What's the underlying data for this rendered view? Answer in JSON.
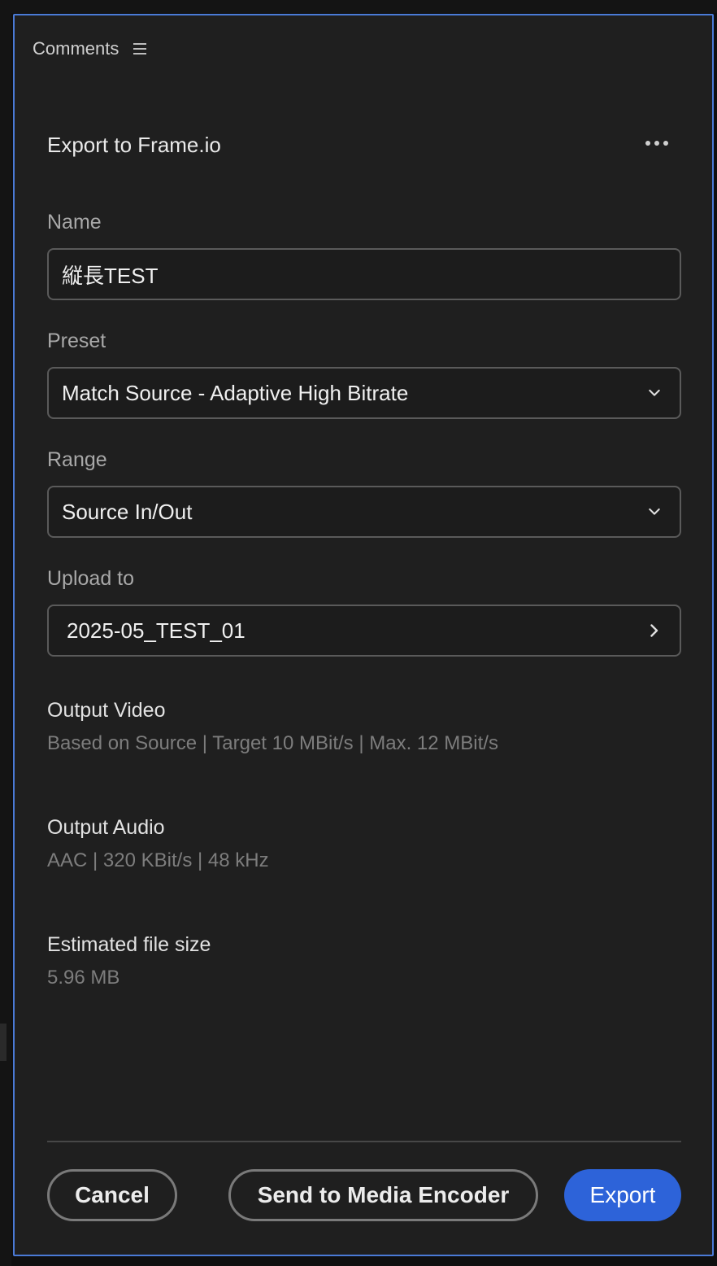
{
  "panel": {
    "title": "Comments",
    "menu_icon": "hamburger-menu-icon"
  },
  "export": {
    "heading": "Export to Frame.io",
    "more_icon": "ellipsis-icon"
  },
  "form": {
    "name": {
      "label": "Name",
      "value": "縦長TEST"
    },
    "preset": {
      "label": "Preset",
      "value": "Match Source - Adaptive High Bitrate",
      "icon": "chevron-down-icon"
    },
    "range": {
      "label": "Range",
      "value": "Source In/Out",
      "icon": "chevron-down-icon"
    },
    "upload": {
      "label": "Upload to",
      "value": "2025-05_TEST_01",
      "icon": "chevron-right-icon"
    }
  },
  "output": {
    "video": {
      "title": "Output Video",
      "value": "Based on Source | Target 10 MBit/s | Max. 12 MBit/s"
    },
    "audio": {
      "title": "Output Audio",
      "value": "AAC | 320 KBit/s | 48 kHz"
    },
    "file_size": {
      "title": "Estimated file size",
      "value": "5.96 MB"
    }
  },
  "buttons": {
    "cancel": "Cancel",
    "media_encoder": "Send to Media Encoder",
    "export": "Export"
  },
  "colors": {
    "panel_background": "#1f1f1f",
    "panel_border": "#4a7ad6",
    "primary_button": "#2d63d9"
  }
}
